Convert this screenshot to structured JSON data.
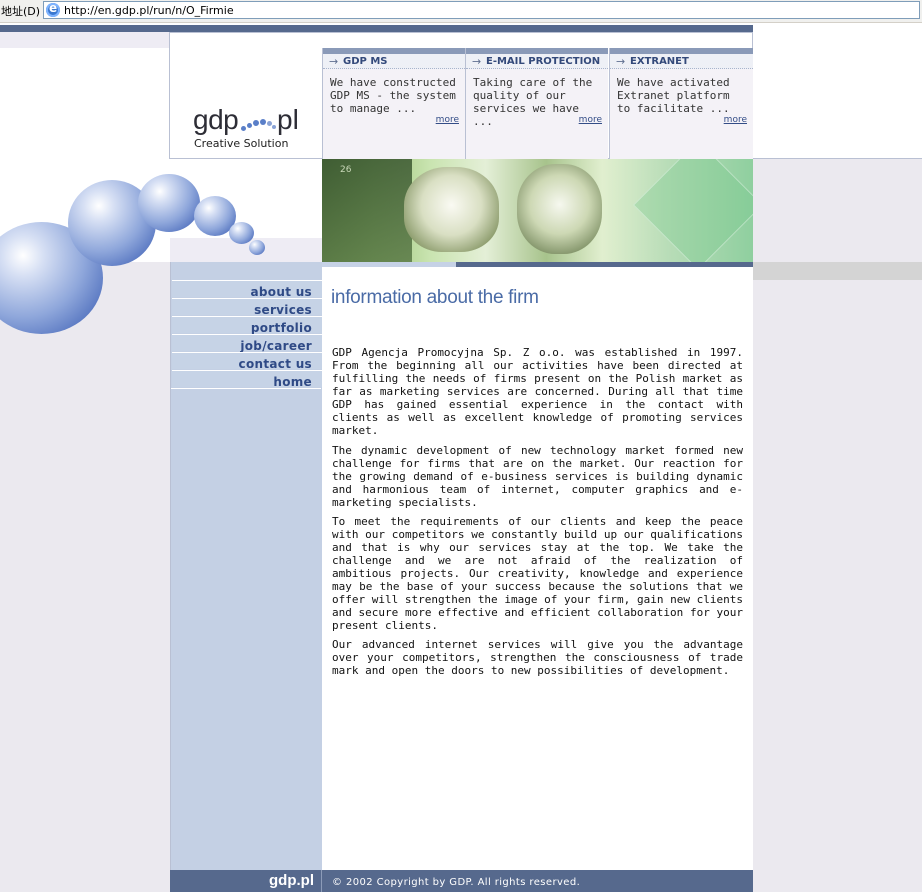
{
  "browser": {
    "address_label": "地址(D)",
    "url": "http://en.gdp.pl/run/n/O_Firmie"
  },
  "logo": {
    "text_left": "gdp",
    "text_right": "pl",
    "tagline": "Creative Solution"
  },
  "news": [
    {
      "title": "GDP MS",
      "text": "We have constructed GDP MS - the system to manage ...",
      "more": "more"
    },
    {
      "title": "E-MAIL PROTECTION",
      "text": "Taking care of the quality of our services we have ...",
      "more": "more"
    },
    {
      "title": "EXTRANET",
      "text": "We have activated Extranet platform to facilitate ...",
      "more": "more"
    }
  ],
  "nav": [
    {
      "label": "about us"
    },
    {
      "label": "services"
    },
    {
      "label": "portfolio"
    },
    {
      "label": "job/career"
    },
    {
      "label": "contact us"
    },
    {
      "label": "home"
    }
  ],
  "main": {
    "title": "information about the firm",
    "paragraphs": [
      "GDP Agencja Promocyjna Sp. Z o.o. was established in 1997. From the beginning all our activities have been directed at fulfilling the needs of firms present on the Polish market as far as marketing services are concerned. During all that time GDP has gained essential experience in the contact with clients as well as excellent knowledge of promoting services market.",
      "The dynamic development of new technology market formed new challenge for firms that are on the market. Our reaction for the growing demand of e-business services is building dynamic and harmonious team of internet, computer graphics and e-marketing specialists.",
      "To meet the requirements of our clients and keep the peace with our competitors we constantly build up our qualifications and that is why our services stay at the top. We take the challenge and we are not afraid of the realization of ambitious projects. Our creativity, knowledge and experience may be the base of your success because the solutions that we offer will strengthen the image of your firm, gain new clients and secure more effective and efficient collaboration for your present clients.",
      "Our advanced internet services will give you the advantage over your competitors, strengthen the consciousness of trade mark and open the doors to new possibilities of development."
    ]
  },
  "footer": {
    "logo": "gdp.pl",
    "copyright": "© 2002 Copyright by GDP.  All rights reserved."
  },
  "photo": {
    "number": "26"
  },
  "colors": {
    "accent": "#56698d",
    "nav_text": "#2f4a86",
    "title": "#4a6ba6",
    "sidebar": "#c4d0e4"
  }
}
